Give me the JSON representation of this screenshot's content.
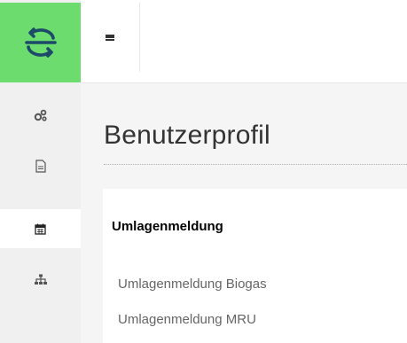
{
  "brand": {
    "logo_icon": "logo-arrows-icon",
    "logo_bg_color": "#6cdc6e",
    "logo_fg_color": "#1c4a68"
  },
  "sidebar": {
    "items": [
      {
        "icon": "cogs-icon",
        "active": false
      },
      {
        "icon": "document-icon",
        "active": false
      },
      {
        "icon": "calendar-icon",
        "active": true
      },
      {
        "icon": "sitemap-icon",
        "active": false
      }
    ]
  },
  "header": {
    "menu_icon": "hamburger-icon"
  },
  "main": {
    "page_title": "Benutzerprofil",
    "section_heading": "Umlagenmeldung",
    "links": [
      {
        "label": "Umlagenmeldung Biogas"
      },
      {
        "label": "Umlagenmeldung MRU"
      }
    ]
  }
}
